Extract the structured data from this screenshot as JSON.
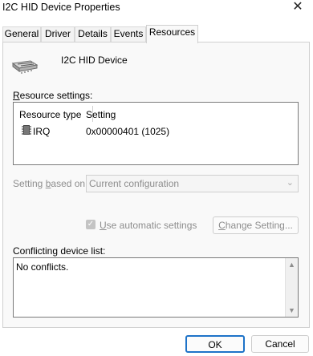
{
  "window": {
    "title": "I2C HID Device Properties",
    "close_glyph": "✕"
  },
  "tabs": [
    {
      "label": "General",
      "active": false
    },
    {
      "label": "Driver",
      "active": false
    },
    {
      "label": "Details",
      "active": false
    },
    {
      "label": "Events",
      "active": false
    },
    {
      "label": "Resources",
      "active": true
    }
  ],
  "device": {
    "name": "I2C HID Device",
    "icon": "hid-device-icon"
  },
  "resource_settings": {
    "label_accel": "R",
    "label_rest": "esource settings:",
    "columns": [
      "Resource type",
      "Setting"
    ],
    "rows": [
      {
        "type": "IRQ",
        "setting": "0x00000401 (1025)",
        "icon": "irq-chip-icon"
      }
    ]
  },
  "setting_based_on": {
    "label_pre": "Setting ",
    "label_accel": "b",
    "label_post": "ased on:",
    "value": "Current configuration"
  },
  "auto_settings": {
    "checked": true,
    "label_accel": "U",
    "label_rest": "se automatic settings"
  },
  "change_button": {
    "label_accel": "C",
    "label_rest": "hange Setting..."
  },
  "conflicts": {
    "label": "Conflicting device list:",
    "text": "No conflicts."
  },
  "footer": {
    "ok": "OK",
    "cancel": "Cancel"
  },
  "colors": {
    "accent": "#1e73c8",
    "disabled_text": "#8d8d8d"
  }
}
